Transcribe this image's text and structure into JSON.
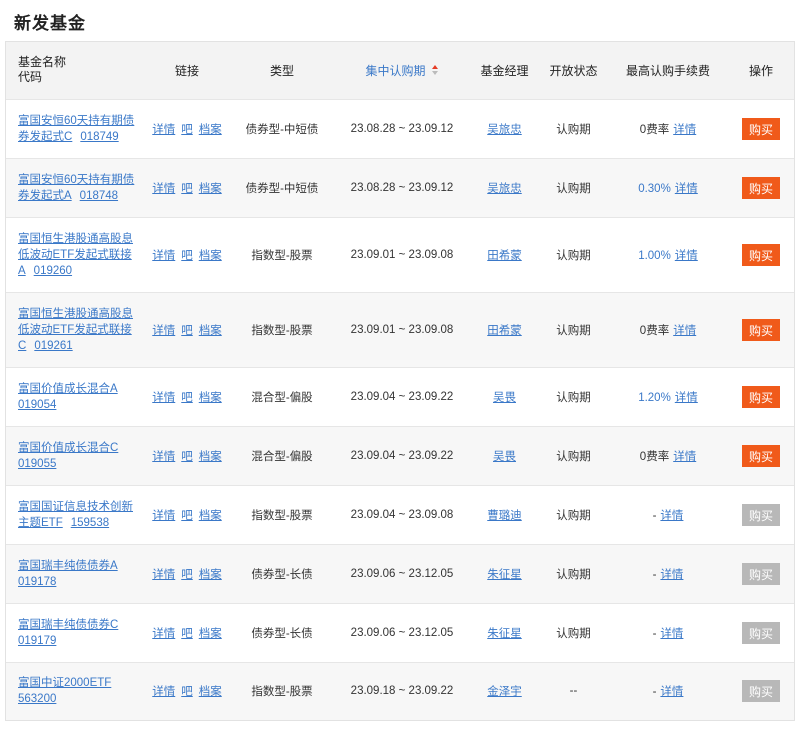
{
  "page_title": "新发基金",
  "header": {
    "name_line1": "基金名称",
    "name_line2": "代码",
    "links": "链接",
    "type": "类型",
    "period": "集中认购期",
    "manager": "基金经理",
    "status": "开放状态",
    "fee": "最高认购手续费",
    "action": "操作"
  },
  "sort_indicator": {
    "column": "period",
    "direction": "asc",
    "active_color": "#e53c26"
  },
  "colors": {
    "link": "#3a78c8",
    "buy_active": "#f05a1a",
    "buy_disabled": "#b8b8b8",
    "header_bg": "#f3f3f3"
  },
  "link_labels": {
    "detail": "详情",
    "bar": "吧",
    "archive": "档案"
  },
  "fee_link_label": "详情",
  "buy_label": "购买",
  "rows": [
    {
      "name_l1": "富国安恒60天持有期债",
      "name_l2": "券发起式C",
      "name_l3": "",
      "code": "018749",
      "type": "债券型-中短债",
      "period": "23.08.28 ~ 23.09.12",
      "manager": "吴旅忠",
      "status": "认购期",
      "fee": "0费率",
      "fee_blue": false,
      "buy_enabled": true,
      "h": 59
    },
    {
      "name_l1": "富国安恒60天持有期债",
      "name_l2": "券发起式A",
      "name_l3": "",
      "code": "018748",
      "type": "债券型-中短债",
      "period": "23.08.28 ~ 23.09.12",
      "manager": "吴旅忠",
      "status": "认购期",
      "fee": "0.30%",
      "fee_blue": true,
      "buy_enabled": true,
      "h": 59
    },
    {
      "name_l1": "富国恒生港股通高股息",
      "name_l2": "低波动ETF发起式联接",
      "name_l3": "A",
      "code": "019260",
      "type": "指数型-股票",
      "period": "23.09.01 ~ 23.09.08",
      "manager": "田希蒙",
      "status": "认购期",
      "fee": "1.00%",
      "fee_blue": true,
      "buy_enabled": true,
      "h": 75
    },
    {
      "name_l1": "富国恒生港股通高股息",
      "name_l2": "低波动ETF发起式联接",
      "name_l3": "C",
      "code": "019261",
      "type": "指数型-股票",
      "period": "23.09.01 ~ 23.09.08",
      "manager": "田希蒙",
      "status": "认购期",
      "fee": "0费率",
      "fee_blue": false,
      "buy_enabled": true,
      "h": 75
    },
    {
      "name_l1": "富国价值成长混合A",
      "name_l2": "",
      "name_l3": "",
      "code": "019054",
      "type": "混合型-偏股",
      "period": "23.09.04 ~ 23.09.22",
      "manager": "吴畏",
      "status": "认购期",
      "fee": "1.20%",
      "fee_blue": true,
      "buy_enabled": true,
      "h": 59
    },
    {
      "name_l1": "富国价值成长混合C",
      "name_l2": "",
      "name_l3": "",
      "code": "019055",
      "type": "混合型-偏股",
      "period": "23.09.04 ~ 23.09.22",
      "manager": "吴畏",
      "status": "认购期",
      "fee": "0费率",
      "fee_blue": false,
      "buy_enabled": true,
      "h": 59
    },
    {
      "name_l1": "富国国证信息技术创新",
      "name_l2": "主题ETF",
      "name_l3": "",
      "code": "159538",
      "type": "指数型-股票",
      "period": "23.09.04 ~ 23.09.08",
      "manager": "曹璐迪",
      "status": "认购期",
      "fee": "-",
      "fee_blue": false,
      "buy_enabled": false,
      "h": 59
    },
    {
      "name_l1": "富国瑞丰纯债债券A",
      "name_l2": "",
      "name_l3": "",
      "code": "019178",
      "type": "债券型-长债",
      "period": "23.09.06 ~ 23.12.05",
      "manager": "朱征星",
      "status": "认购期",
      "fee": "-",
      "fee_blue": false,
      "buy_enabled": false,
      "h": 59
    },
    {
      "name_l1": "富国瑞丰纯债债券C",
      "name_l2": "",
      "name_l3": "",
      "code": "019179",
      "type": "债券型-长债",
      "period": "23.09.06 ~ 23.12.05",
      "manager": "朱征星",
      "status": "认购期",
      "fee": "-",
      "fee_blue": false,
      "buy_enabled": false,
      "h": 59
    },
    {
      "name_l1": "富国中证2000ETF",
      "name_l2": "",
      "name_l3": "",
      "code": "563200",
      "type": "指数型-股票",
      "period": "23.09.18 ~ 23.09.22",
      "manager": "金泽宇",
      "status": "--",
      "fee": "-",
      "fee_blue": false,
      "buy_enabled": false,
      "h": 58
    }
  ]
}
